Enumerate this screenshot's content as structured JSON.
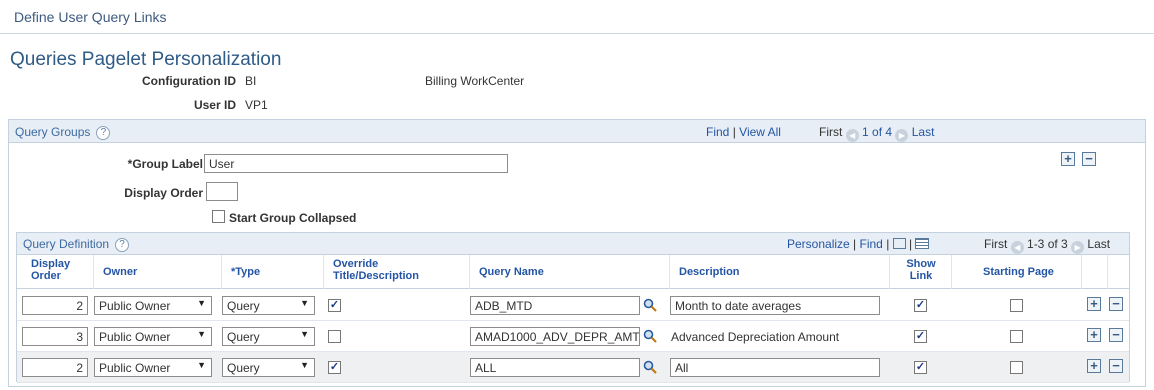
{
  "page_header": "Define User Query Links",
  "page_title": "Queries Pagelet Personalization",
  "config": {
    "config_id_label": "Configuration ID",
    "config_id": "BI",
    "config_desc": "Billing WorkCenter",
    "user_id_label": "User ID",
    "user_id": "VP1"
  },
  "groups": {
    "title": "Query Groups",
    "find": "Find",
    "sep": "|",
    "view_all": "View All",
    "first": "First",
    "range": "1 of 4",
    "last": "Last",
    "group_label_label": "*Group Label",
    "group_label_value": "User",
    "display_order_label": "Display Order",
    "display_order_value": "",
    "start_collapsed_label": "Start Group Collapsed"
  },
  "querydef": {
    "title": "Query Definition",
    "personalize": "Personalize",
    "sep": "|",
    "find": "Find",
    "sep2": "|",
    "first": "First",
    "range": "1-3 of 3",
    "last": "Last",
    "columns": {
      "display_order_1": "Display",
      "display_order_2": "Order",
      "owner": "Owner",
      "type": "*Type",
      "override_1": "Override",
      "override_2": "Title/Description",
      "query_name": "Query Name",
      "description": "Description",
      "show_link_1": "Show",
      "show_link_2": "Link",
      "starting_page": "Starting Page"
    },
    "rows": [
      {
        "order": "2",
        "owner": "Public Owner",
        "type": "Query",
        "override": true,
        "query": "ADB_MTD",
        "desc": "Month to date averages",
        "show": true,
        "start": false
      },
      {
        "order": "3",
        "owner": "Public Owner",
        "type": "Query",
        "override": false,
        "query": "AMAD1000_ADV_DEPR_AMT",
        "desc": "Advanced Depreciation Amount",
        "show": true,
        "start": false
      },
      {
        "order": "2",
        "owner": "Public Owner",
        "type": "Query",
        "override": true,
        "query": "ALL",
        "desc": "All",
        "show": true,
        "start": false
      }
    ]
  },
  "glyphs": {
    "check": "✓",
    "plus": "+",
    "minus": "−",
    "prev": "◀",
    "next": "▶",
    "arrow": "▼",
    "help": "?"
  }
}
